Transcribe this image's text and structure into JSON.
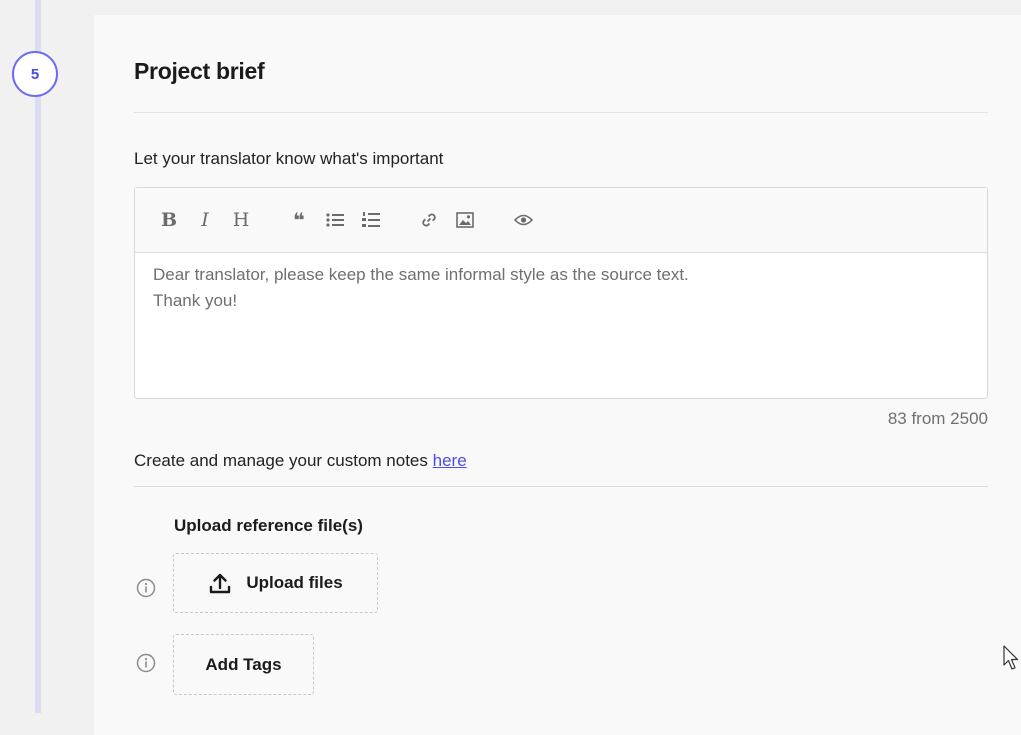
{
  "step": {
    "number": "5"
  },
  "section": {
    "title": "Project brief",
    "label": "Let your translator know what's important"
  },
  "editor": {
    "toolbar": [
      {
        "name": "bold-button",
        "glyph": "B"
      },
      {
        "name": "italic-button",
        "glyph": "I"
      },
      {
        "name": "heading-button",
        "glyph": "H"
      },
      {
        "name": "quote-button",
        "glyph": "❝"
      },
      {
        "name": "unordered-list-button",
        "glyph": "bullet-list-icon"
      },
      {
        "name": "ordered-list-button",
        "glyph": "numbered-list-icon"
      },
      {
        "name": "link-button",
        "glyph": "link-icon"
      },
      {
        "name": "image-button",
        "glyph": "image-icon"
      },
      {
        "name": "preview-button",
        "glyph": "eye-icon"
      }
    ],
    "lines": [
      "Dear translator, please keep the same informal style as the source text.",
      "Thank you!"
    ],
    "counter": "83 from 2500"
  },
  "notes": {
    "text": "Create and manage your custom notes ",
    "link": "here"
  },
  "upload": {
    "label": "Upload reference file(s)",
    "button": "Upload files"
  },
  "tags": {
    "button": "Add Tags"
  },
  "colors": {
    "accent": "#6c6cf0",
    "link": "#4d4de8",
    "rail": "#dcdcf3",
    "background": "#f1f1f1",
    "card": "#f9f9f9"
  }
}
